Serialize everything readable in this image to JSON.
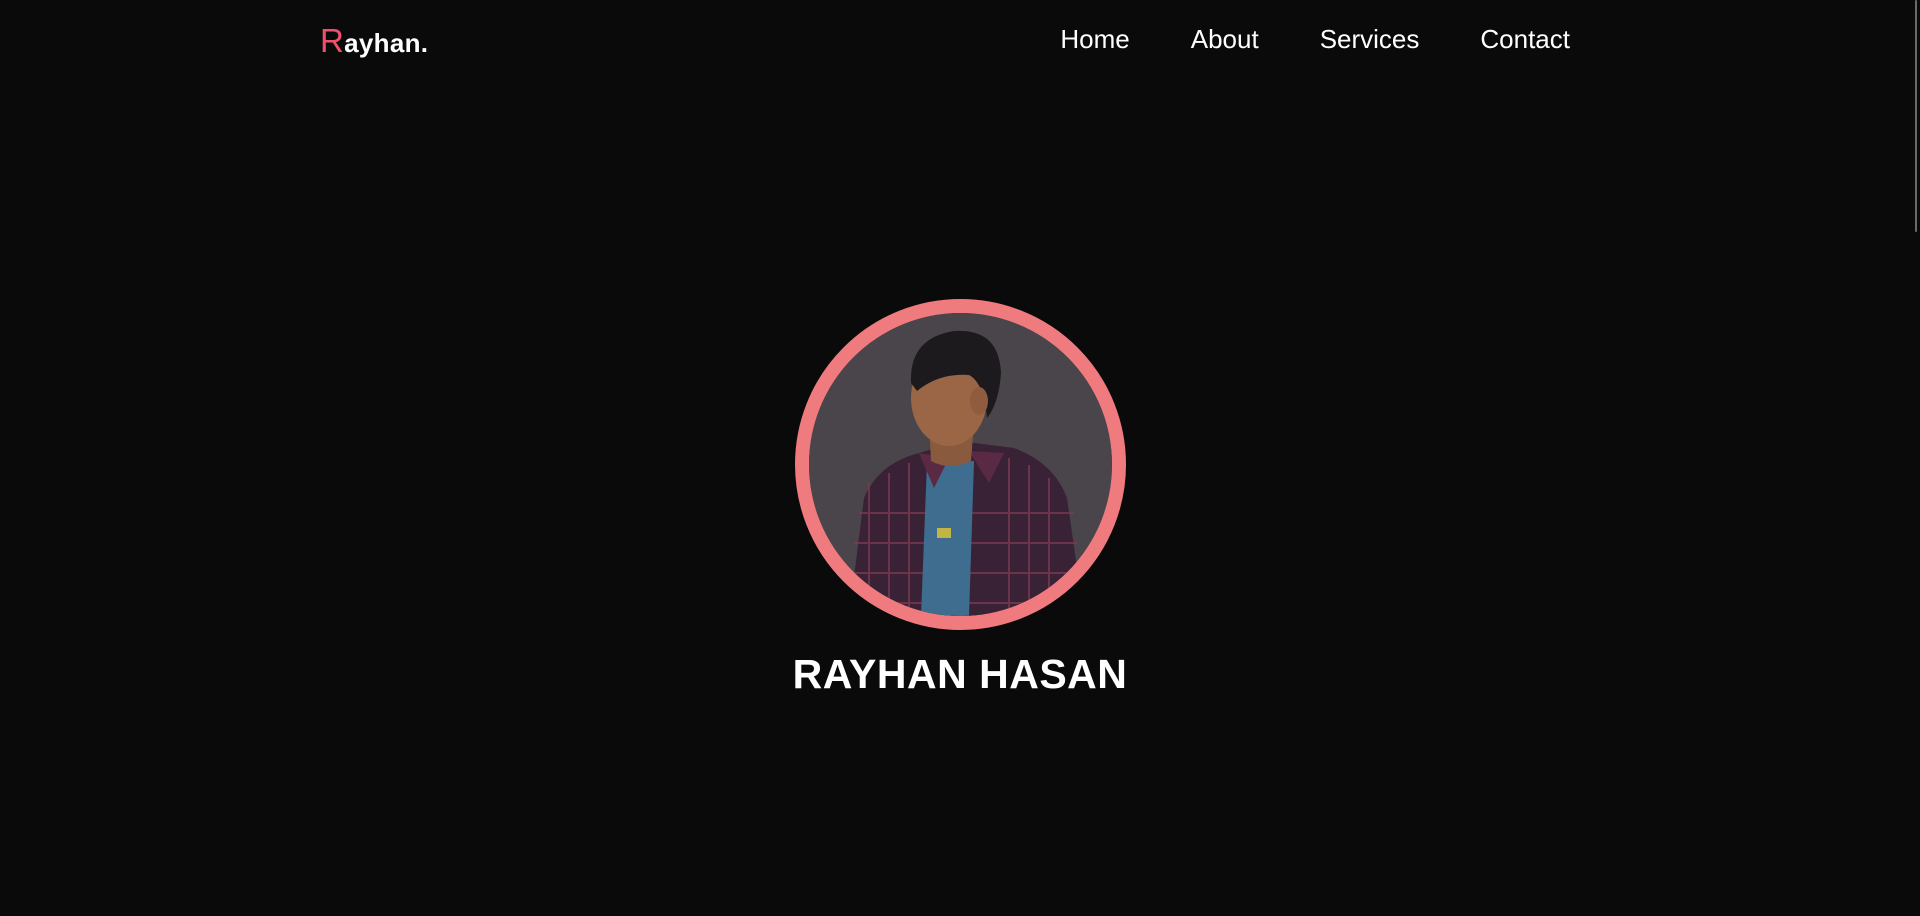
{
  "header": {
    "logo": {
      "initial": "R",
      "rest": "ayhan."
    },
    "nav": [
      {
        "label": "Home"
      },
      {
        "label": "About"
      },
      {
        "label": "Services"
      },
      {
        "label": "Contact"
      }
    ]
  },
  "hero": {
    "name": "RAYHAN HASAN",
    "avatar_icon": "profile-photo"
  },
  "colors": {
    "background": "#0a0a0a",
    "accent": "#f0506e",
    "ring": "#f07b7f",
    "text": "#ffffff"
  }
}
